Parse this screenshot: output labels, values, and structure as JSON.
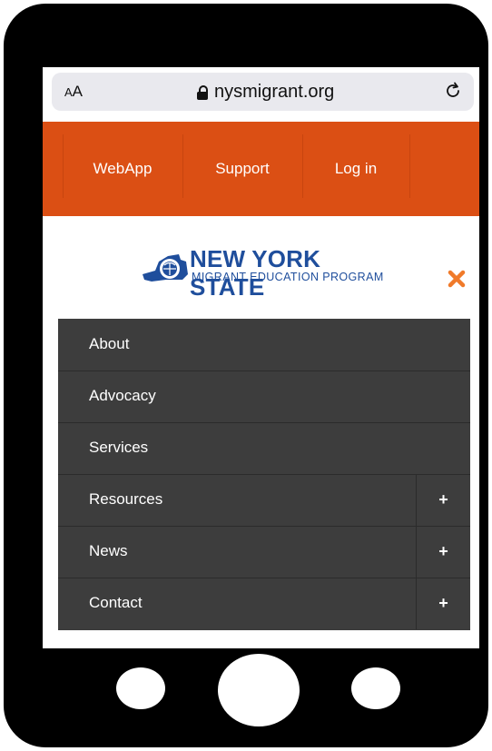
{
  "browser": {
    "aa_small": "A",
    "aa_large": "A",
    "url": "nysmigrant.org",
    "lock_icon": "lock-icon",
    "reload_icon": "reload-icon"
  },
  "top_nav": {
    "items": [
      {
        "label": "WebApp"
      },
      {
        "label": "Support"
      },
      {
        "label": "Log in"
      }
    ],
    "background": "#db4f14"
  },
  "logo": {
    "title": "NEW YORK STATE",
    "subtitle": "MIGRANT EDUCATION PROGRAM",
    "color": "#1f4e9c"
  },
  "close_icon": "close-icon",
  "close_color": "#f07a2a",
  "menu": {
    "items": [
      {
        "label": "About",
        "expandable": false
      },
      {
        "label": "Advocacy",
        "expandable": false
      },
      {
        "label": "Services",
        "expandable": false
      },
      {
        "label": "Resources",
        "expandable": true,
        "toggle": "+"
      },
      {
        "label": "News",
        "expandable": true,
        "toggle": "+"
      },
      {
        "label": "Contact",
        "expandable": true,
        "toggle": "+"
      }
    ],
    "background": "#3d3d3d"
  }
}
